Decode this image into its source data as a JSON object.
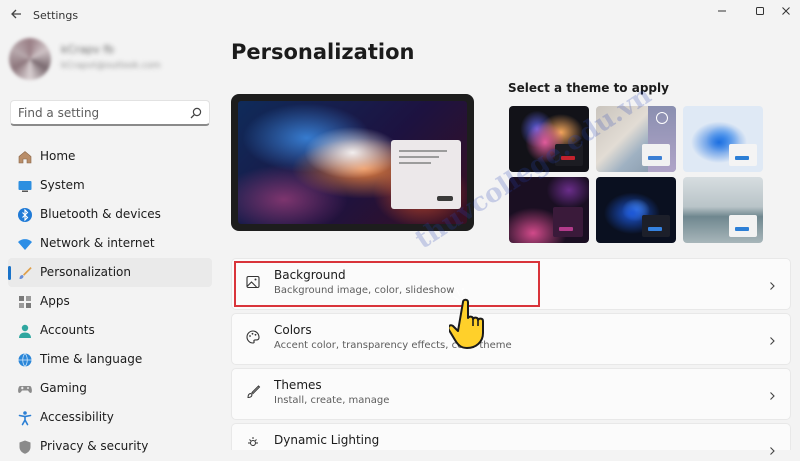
{
  "window": {
    "title": "Settings"
  },
  "user": {
    "name": "kCrapv fb",
    "email": "kCrapvt@outlook.com"
  },
  "search": {
    "placeholder": "Find a setting"
  },
  "nav": {
    "items": [
      {
        "label": "Home",
        "icon": "home-icon"
      },
      {
        "label": "System",
        "icon": "system-icon"
      },
      {
        "label": "Bluetooth & devices",
        "icon": "bluetooth-icon"
      },
      {
        "label": "Network & internet",
        "icon": "wifi-icon"
      },
      {
        "label": "Personalization",
        "icon": "brush-icon",
        "active": true
      },
      {
        "label": "Apps",
        "icon": "apps-icon"
      },
      {
        "label": "Accounts",
        "icon": "person-icon"
      },
      {
        "label": "Time & language",
        "icon": "globe-icon"
      },
      {
        "label": "Gaming",
        "icon": "gamepad-icon"
      },
      {
        "label": "Accessibility",
        "icon": "accessibility-icon"
      },
      {
        "label": "Privacy & security",
        "icon": "shield-icon"
      }
    ]
  },
  "main": {
    "title": "Personalization",
    "themes_title": "Select a theme to apply",
    "accent_color": "#1a73c9",
    "cards": [
      {
        "title": "Background",
        "subtitle": "Background image, color, slideshow",
        "icon": "image-icon"
      },
      {
        "title": "Colors",
        "subtitle": "Accent color, transparency effects, color theme",
        "icon": "palette-icon"
      },
      {
        "title": "Themes",
        "subtitle": "Install, create, manage",
        "icon": "brush-icon"
      },
      {
        "title": "Dynamic Lighting",
        "subtitle": "",
        "icon": "lighting-icon"
      }
    ]
  },
  "watermark": {
    "text": "thuvcollege.edu.vn"
  },
  "highlight_color": "#d9343a"
}
